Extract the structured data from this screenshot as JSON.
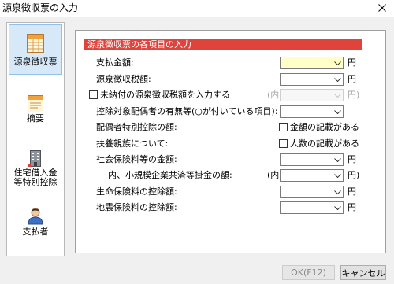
{
  "window": {
    "title": "源泉徴収票の入力"
  },
  "icons": {
    "close": "close-icon",
    "dropdown": "chevron-down-icon"
  },
  "colors": {
    "section_header": "#e0433b",
    "section_header_text": "#ffffff",
    "nav_selected_bg": "#d7e8f8",
    "nav_selected_border": "#8fc1ec",
    "focused_input_bg": "#ffffc7"
  },
  "nav": {
    "items": [
      {
        "label": "源泉徴収票",
        "icon": "withholding-slip-icon",
        "selected": true
      },
      {
        "label": "摘要",
        "icon": "memo-icon",
        "selected": false
      },
      {
        "label_lines": [
          "住宅借入金",
          "等特別控除"
        ],
        "icon": "housing-loan-deduction-icon",
        "selected": false
      },
      {
        "label": "支払者",
        "icon": "payer-icon",
        "selected": false
      }
    ]
  },
  "form": {
    "header": "源泉徴収票の各項目の入力",
    "rows": [
      {
        "label": "支払金額:",
        "value": "",
        "unit": "円",
        "focused": true
      },
      {
        "label": "源泉徴収税額:",
        "value": "",
        "unit": "円"
      },
      {
        "checkbox_label": "未納付の源泉徴収税額を入力する",
        "checked": false,
        "prefix": "(内",
        "value": "",
        "unit": "円)",
        "input_disabled": true
      },
      {
        "label": "控除対象配偶者の有無等(○が付いている項目):",
        "value": ""
      },
      {
        "label": "配偶者特別控除の額:",
        "checkbox_label": "金額の記載がある",
        "checked": false
      },
      {
        "label": "扶養親族について:",
        "checkbox_label": "人数の記載がある",
        "checked": false
      },
      {
        "label": "社会保険料等の金額:",
        "value": "",
        "unit": "円"
      },
      {
        "label": "内、小規模企業共済等掛金の額:",
        "prefix": "(内",
        "value": "",
        "unit": "円)"
      },
      {
        "label": "生命保険料の控除額:",
        "value": "",
        "unit": "円"
      },
      {
        "label": "地震保険料の控除額:",
        "value": "",
        "unit": "円"
      }
    ]
  },
  "buttons": {
    "ok": {
      "label": "OK(F12)",
      "enabled": false
    },
    "cancel": {
      "label": "キャンセル",
      "enabled": true
    }
  }
}
